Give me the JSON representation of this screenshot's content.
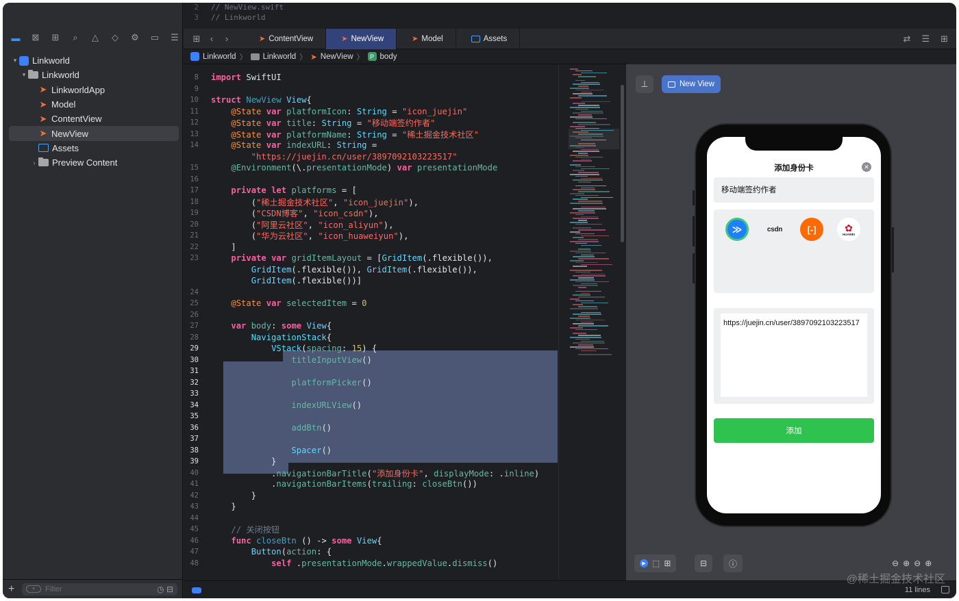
{
  "navigator": {
    "toolbar_icons": [
      "folder-icon",
      "source-control-icon",
      "symbol-icon",
      "find-icon",
      "issue-icon",
      "test-icon",
      "debug-icon",
      "breakpoint-icon",
      "report-icon"
    ],
    "tree": [
      {
        "label": "Linkworld",
        "type": "project",
        "disclosure": "▾"
      },
      {
        "label": "Linkworld",
        "type": "folder",
        "disclosure": "▾"
      },
      {
        "label": "LinkworldApp",
        "type": "swift"
      },
      {
        "label": "Model",
        "type": "swift"
      },
      {
        "label": "ContentView",
        "type": "swift"
      },
      {
        "label": "NewView",
        "type": "swift",
        "selected": true
      },
      {
        "label": "Assets",
        "type": "assets"
      },
      {
        "label": "Preview Content",
        "type": "folder",
        "disclosure": "›"
      }
    ],
    "filter_placeholder": "Filter"
  },
  "editor": {
    "ghost_lines": [
      {
        "num": "2",
        "text": "//  NewView.swift"
      },
      {
        "num": "3",
        "text": "//  Linkworld"
      }
    ],
    "tabs": [
      {
        "label": "ContentView",
        "icon": "swift-icon"
      },
      {
        "label": "NewView",
        "icon": "swift-icon",
        "active": true
      },
      {
        "label": "Model",
        "icon": "swift-icon"
      },
      {
        "label": "Assets",
        "icon": "assets-icon"
      }
    ],
    "jumpbar": [
      "Linkworld",
      "Linkworld",
      "NewView",
      "body"
    ],
    "jumpbar_badge": "P",
    "status": {
      "lines": "11 lines"
    }
  },
  "code": [
    {
      "n": "8",
      "t": [
        [
          "kw",
          "import"
        ],
        [
          "",
          "SwiftUI"
        ]
      ]
    },
    {
      "n": "9",
      "t": []
    },
    {
      "n": "10",
      "t": [
        [
          "kw",
          "struct"
        ],
        [
          "df",
          "NewView"
        ],
        [
          ":",
          ""
        ],
        [
          "ty",
          "View"
        ],
        [
          "",
          "{"
        ]
      ]
    },
    {
      "n": "11",
      "t": [
        [
          "",
          "    "
        ],
        [
          "at",
          "@State"
        ],
        [
          "kw",
          "var"
        ],
        [
          "pr",
          "platformIcon"
        ],
        [
          "",
          ": "
        ],
        [
          "ty",
          "String"
        ],
        [
          "",
          " = "
        ],
        [
          "st",
          "\"icon_juejin\""
        ]
      ]
    },
    {
      "n": "12",
      "t": [
        [
          "",
          "    "
        ],
        [
          "at",
          "@State"
        ],
        [
          "kw",
          "var"
        ],
        [
          "pr",
          "title"
        ],
        [
          "",
          ": "
        ],
        [
          "ty",
          "String"
        ],
        [
          "",
          " = "
        ],
        [
          "st",
          "\"移动端签约作者\""
        ]
      ]
    },
    {
      "n": "13",
      "t": [
        [
          "",
          "    "
        ],
        [
          "at",
          "@State"
        ],
        [
          "kw",
          "var"
        ],
        [
          "pr",
          "platformName"
        ],
        [
          "",
          ": "
        ],
        [
          "ty",
          "String"
        ],
        [
          "",
          " = "
        ],
        [
          "st",
          "\"稀土掘金技术社区\""
        ]
      ]
    },
    {
      "n": "14",
      "t": [
        [
          "",
          "    "
        ],
        [
          "at",
          "@State"
        ],
        [
          "kw",
          "var"
        ],
        [
          "pr",
          "indexURL"
        ],
        [
          "",
          ": "
        ],
        [
          "ty",
          "String"
        ],
        [
          "",
          " ="
        ]
      ]
    },
    {
      "n": "",
      "t": [
        [
          "",
          "        "
        ],
        [
          "st",
          "\"https://juejin.cn/user/3897092103223517\""
        ]
      ]
    },
    {
      "n": "15",
      "t": [
        [
          "",
          "    "
        ],
        [
          "pr",
          "@Environment"
        ],
        [
          "",
          "(\\."
        ],
        [
          "pr",
          "presentationMode"
        ],
        [
          "",
          ") "
        ],
        [
          "kw",
          "var"
        ],
        [
          "pr",
          "presentationMode"
        ]
      ]
    },
    {
      "n": "16",
      "t": []
    },
    {
      "n": "17",
      "t": [
        [
          "",
          "    "
        ],
        [
          "kw",
          "private"
        ],
        [
          "kw",
          "let"
        ],
        [
          "pr",
          "platforms"
        ],
        [
          "",
          " = ["
        ]
      ]
    },
    {
      "n": "18",
      "t": [
        [
          "",
          "        ("
        ],
        [
          "st",
          "\"稀土掘金技术社区\""
        ],
        [
          "",
          ", "
        ],
        [
          "st",
          "\"icon_juejin\""
        ],
        [
          "",
          "),"
        ]
      ]
    },
    {
      "n": "19",
      "t": [
        [
          "",
          "        ("
        ],
        [
          "st",
          "\"CSDN博客\""
        ],
        [
          "",
          ", "
        ],
        [
          "st",
          "\"icon_csdn\""
        ],
        [
          "",
          "),"
        ]
      ]
    },
    {
      "n": "20",
      "t": [
        [
          "",
          "        ("
        ],
        [
          "st",
          "\"阿里云社区\""
        ],
        [
          "",
          ", "
        ],
        [
          "st",
          "\"icon_aliyun\""
        ],
        [
          "",
          "),"
        ]
      ]
    },
    {
      "n": "21",
      "t": [
        [
          "",
          "        ("
        ],
        [
          "st",
          "\"华为云社区\""
        ],
        [
          "",
          ", "
        ],
        [
          "st",
          "\"icon_huaweiyun\""
        ],
        [
          "",
          "),"
        ]
      ]
    },
    {
      "n": "22",
      "t": [
        [
          "",
          "    ]"
        ]
      ]
    },
    {
      "n": "23",
      "t": [
        [
          "",
          "    "
        ],
        [
          "kw",
          "private"
        ],
        [
          "kw",
          "var"
        ],
        [
          "pr",
          "gridItemLayout"
        ],
        [
          "",
          " = ["
        ],
        [
          "ty",
          "GridItem"
        ],
        [
          "",
          "(.flexible()),"
        ]
      ]
    },
    {
      "n": "",
      "t": [
        [
          "",
          "        "
        ],
        [
          "ty",
          "GridItem"
        ],
        [
          "",
          "(.flexible()), "
        ],
        [
          "ty",
          "GridItem"
        ],
        [
          "",
          "(.flexible()),"
        ]
      ]
    },
    {
      "n": "",
      "t": [
        [
          "",
          "        "
        ],
        [
          "ty",
          "GridItem"
        ],
        [
          "",
          "(.flexible())]"
        ]
      ]
    },
    {
      "n": "24",
      "t": []
    },
    {
      "n": "25",
      "t": [
        [
          "",
          "    "
        ],
        [
          "at",
          "@State"
        ],
        [
          "kw",
          "var"
        ],
        [
          "pr",
          "selectedItem"
        ],
        [
          "",
          " = "
        ],
        [
          "nm",
          "0"
        ]
      ]
    },
    {
      "n": "26",
      "t": []
    },
    {
      "n": "27",
      "t": [
        [
          "",
          "    "
        ],
        [
          "kw",
          "var"
        ],
        [
          "pr",
          "body"
        ],
        [
          "",
          ": "
        ],
        [
          "kw",
          "some"
        ],
        [
          "ty",
          "View"
        ],
        [
          "",
          "{"
        ]
      ]
    },
    {
      "n": "28",
      "t": [
        [
          "",
          "        "
        ],
        [
          "ty",
          "NavigationStack"
        ],
        [
          "",
          "{"
        ]
      ]
    },
    {
      "n": "29",
      "t": [
        [
          "",
          "            "
        ],
        [
          "ty",
          "VStack"
        ],
        [
          "",
          "("
        ],
        [
          "pr",
          "spacing"
        ],
        [
          "",
          ": "
        ],
        [
          "nm",
          "15"
        ],
        [
          "",
          ") {"
        ]
      ]
    },
    {
      "n": "30",
      "t": [
        [
          "",
          "                "
        ],
        [
          "fn",
          "titleInputView"
        ],
        [
          "",
          "()"
        ]
      ]
    },
    {
      "n": "31",
      "t": []
    },
    {
      "n": "32",
      "t": [
        [
          "",
          "                "
        ],
        [
          "fn",
          "platformPicker"
        ],
        [
          "",
          "()"
        ]
      ]
    },
    {
      "n": "33",
      "t": []
    },
    {
      "n": "34",
      "t": [
        [
          "",
          "                "
        ],
        [
          "fn",
          "indexURLView"
        ],
        [
          "",
          "()"
        ]
      ]
    },
    {
      "n": "35",
      "t": []
    },
    {
      "n": "36",
      "t": [
        [
          "",
          "                "
        ],
        [
          "fn",
          "addBtn"
        ],
        [
          "",
          "()"
        ]
      ]
    },
    {
      "n": "37",
      "t": []
    },
    {
      "n": "38",
      "t": [
        [
          "",
          "                "
        ],
        [
          "ty",
          "Spacer"
        ],
        [
          "",
          "()"
        ]
      ]
    },
    {
      "n": "39",
      "t": [
        [
          "",
          "            }"
        ]
      ]
    },
    {
      "n": "40",
      "t": [
        [
          "",
          "            ."
        ],
        [
          "pr",
          "navigationBarTitle"
        ],
        [
          "",
          "("
        ],
        [
          "st",
          "\"添加身份卡\""
        ],
        [
          "",
          ", "
        ],
        [
          "pr",
          "displayMode"
        ],
        [
          "",
          ": ."
        ],
        [
          "pr",
          "inline"
        ],
        [
          "",
          ")"
        ]
      ]
    },
    {
      "n": "41",
      "t": [
        [
          "",
          "            ."
        ],
        [
          "pr",
          "navigationBarItems"
        ],
        [
          "",
          "("
        ],
        [
          "pr",
          "trailing"
        ],
        [
          "",
          ": "
        ],
        [
          "fn",
          "closeBtn"
        ],
        [
          "",
          "())"
        ]
      ]
    },
    {
      "n": "42",
      "t": [
        [
          "",
          "        }"
        ]
      ]
    },
    {
      "n": "43",
      "t": [
        [
          "",
          "    }"
        ]
      ]
    },
    {
      "n": "44",
      "t": []
    },
    {
      "n": "45",
      "t": [
        [
          "",
          "    "
        ],
        [
          "cm",
          "// 关闭按钮"
        ]
      ]
    },
    {
      "n": "46",
      "t": [
        [
          "",
          "    "
        ],
        [
          "kw",
          "func"
        ],
        [
          "df",
          "closeBtn"
        ],
        [
          "",
          "() -> "
        ],
        [
          "kw",
          "some"
        ],
        [
          "ty",
          "View"
        ],
        [
          "",
          "{"
        ]
      ]
    },
    {
      "n": "47",
      "t": [
        [
          "",
          "        "
        ],
        [
          "ty",
          "Button"
        ],
        [
          "",
          "("
        ],
        [
          "pr",
          "action"
        ],
        [
          "",
          ": {"
        ]
      ]
    },
    {
      "n": "48",
      "t": [
        [
          "",
          "            "
        ],
        [
          "kw",
          "self"
        ],
        [
          "",
          "."
        ],
        [
          "pr",
          "presentationMode"
        ],
        [
          "",
          "."
        ],
        [
          "pr",
          "wrappedValue"
        ],
        [
          "",
          "."
        ],
        [
          "pr",
          "dismiss"
        ],
        [
          "",
          "()"
        ]
      ]
    }
  ],
  "preview": {
    "chip_label": "New View",
    "nav_title": "添加身份卡",
    "title_value": "移动端签约作者",
    "platforms": [
      {
        "name": "juejin",
        "glyph": "≫"
      },
      {
        "name": "csdn",
        "glyph": "csdn"
      },
      {
        "name": "aliyun",
        "glyph": "[-]"
      },
      {
        "name": "huawei",
        "glyph": "✿",
        "caption": "HUAWEI"
      }
    ],
    "url_value": "https://juejin.cn/user/3897092103223517",
    "add_button": "添加",
    "close_glyph": "✕"
  },
  "watermark": "@稀土掘金技术社区",
  "colors": {
    "accent": "#3b82f6",
    "add_button": "#30c24f",
    "tab_active": "#32427a"
  }
}
